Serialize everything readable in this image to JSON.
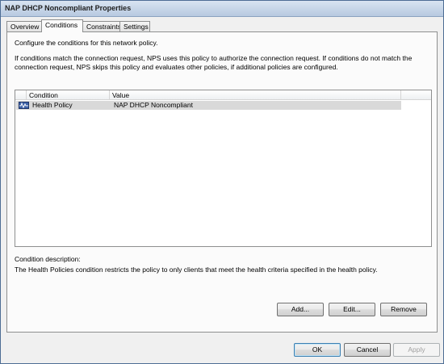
{
  "window": {
    "title": "NAP DHCP Noncompliant Properties"
  },
  "tabs": [
    {
      "label": "Overview"
    },
    {
      "label": "Conditions"
    },
    {
      "label": "Constraints"
    },
    {
      "label": "Settings"
    }
  ],
  "conditions": {
    "intro": "Configure the conditions for this network policy.",
    "explanation_line1": "If conditions match the connection request, NPS uses this policy to authorize the connection request. If conditions do not match the",
    "explanation_line2": "connection request, NPS skips this policy and evaluates other policies, if additional policies are configured.",
    "columns": [
      {
        "label": "Condition"
      },
      {
        "label": "Value"
      }
    ],
    "rows": [
      {
        "condition": "Health Policy",
        "value": "NAP DHCP Noncompliant",
        "icon": "health-policy-icon",
        "selected": true
      }
    ],
    "description_label": "Condition description:",
    "description_text": "The Health Policies condition restricts the policy to only clients that meet the health criteria specified in the health policy.",
    "buttons": {
      "add": "Add...",
      "edit": "Edit...",
      "remove": "Remove"
    }
  },
  "footer": {
    "ok": "OK",
    "cancel": "Cancel",
    "apply": "Apply"
  },
  "colors": {
    "title_gradient_top": "#d9e4f1",
    "selected_row": "#d9d9d9",
    "default_button_border": "#3c7fb1"
  }
}
